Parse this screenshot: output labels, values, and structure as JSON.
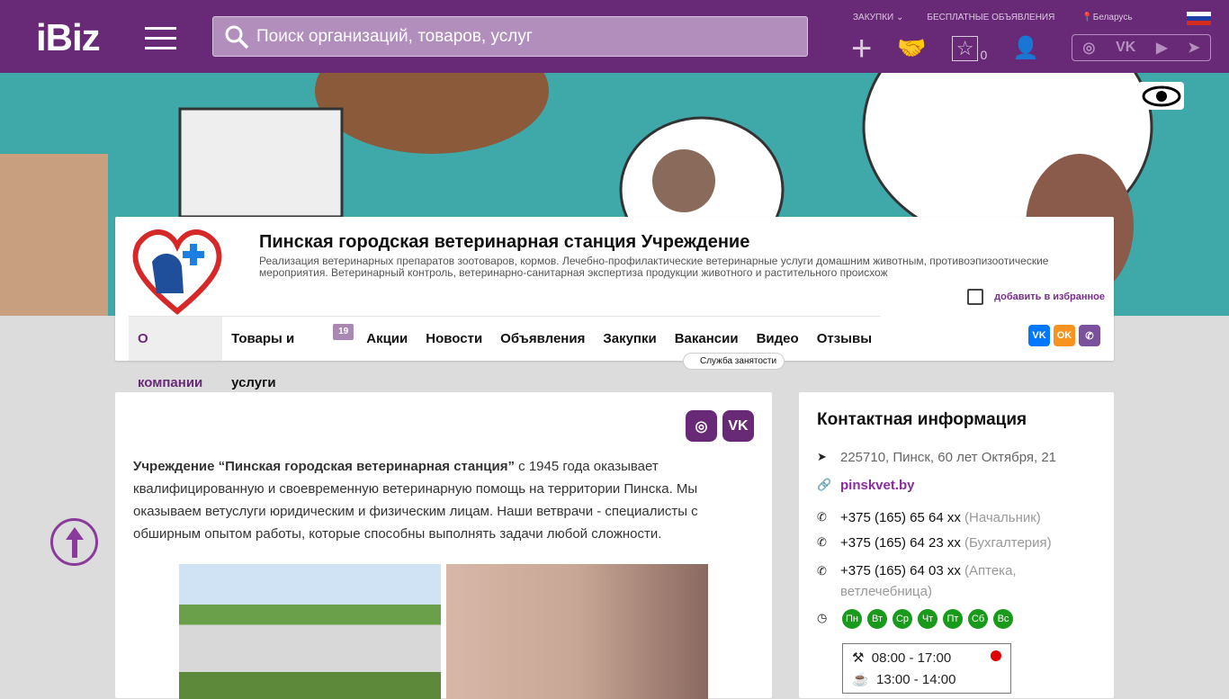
{
  "header": {
    "logo": "iBiz",
    "search_placeholder": "Поиск организаций, товаров, услуг",
    "links": [
      "ЗАКУПКИ",
      "БЕСПЛАТНЫЕ ОБЪЯВЛЕНИЯ"
    ],
    "region": "Беларусь",
    "favorites_count": "0",
    "brand_color": "#682a76"
  },
  "company": {
    "title": "Пинская городская ветеринарная станция Учреждение",
    "description": "Реализация ветеринарных препаратов зоотоваров, кормов. Лечебно-профилактические ветеринарные услуги домашним животным, противоэпизоотические мероприятия. Ветеринарный контроль, ветеринарно-санитарная экспертиза продукции животного и растительного происхож",
    "add_favorite": "добавить в избранное"
  },
  "tabs": [
    {
      "label": "О компании"
    },
    {
      "label": "Товары и услуги",
      "badge": "19"
    },
    {
      "label": "Акции"
    },
    {
      "label": "Новости"
    },
    {
      "label": "Объявления"
    },
    {
      "label": "Закупки"
    },
    {
      "label": "Вакансии"
    },
    {
      "label": "Видео"
    },
    {
      "label": "Отзывы"
    }
  ],
  "tooltip": "Служба занятости",
  "about": {
    "bold": "Учреждение “Пинская городская ветеринарная станция”",
    "text": " с 1945 года оказывает квалифицированную и своевременную ветеринарную помощь на территории Пинска. Мы оказываем ветуслуги юридическим и физическим лицам. Наши ветврачи - специалисты с обширным опытом работы, которые способны выполнять задачи любой сложности."
  },
  "contacts": {
    "title": "Контактная информация",
    "address": "225710, Пинск, 60 лет Октября, 21",
    "site": "pinskvet.by",
    "phones": [
      {
        "number": "+375 (165) 65 64 xx",
        "note": "(Начальник)"
      },
      {
        "number": "+375 (165) 64 23 xx",
        "note": "(Бухгалтерия)"
      },
      {
        "number": "+375 (165) 64 03 xx",
        "note": "(Аптека, ветлечебница)"
      }
    ],
    "days": [
      "Пн",
      "Вт",
      "Ср",
      "Чт",
      "Пт",
      "Сб",
      "Вс"
    ],
    "work_hours": "08:00 - 17:00",
    "break_hours": "13:00 - 14:00",
    "status_color": "#e00000"
  }
}
